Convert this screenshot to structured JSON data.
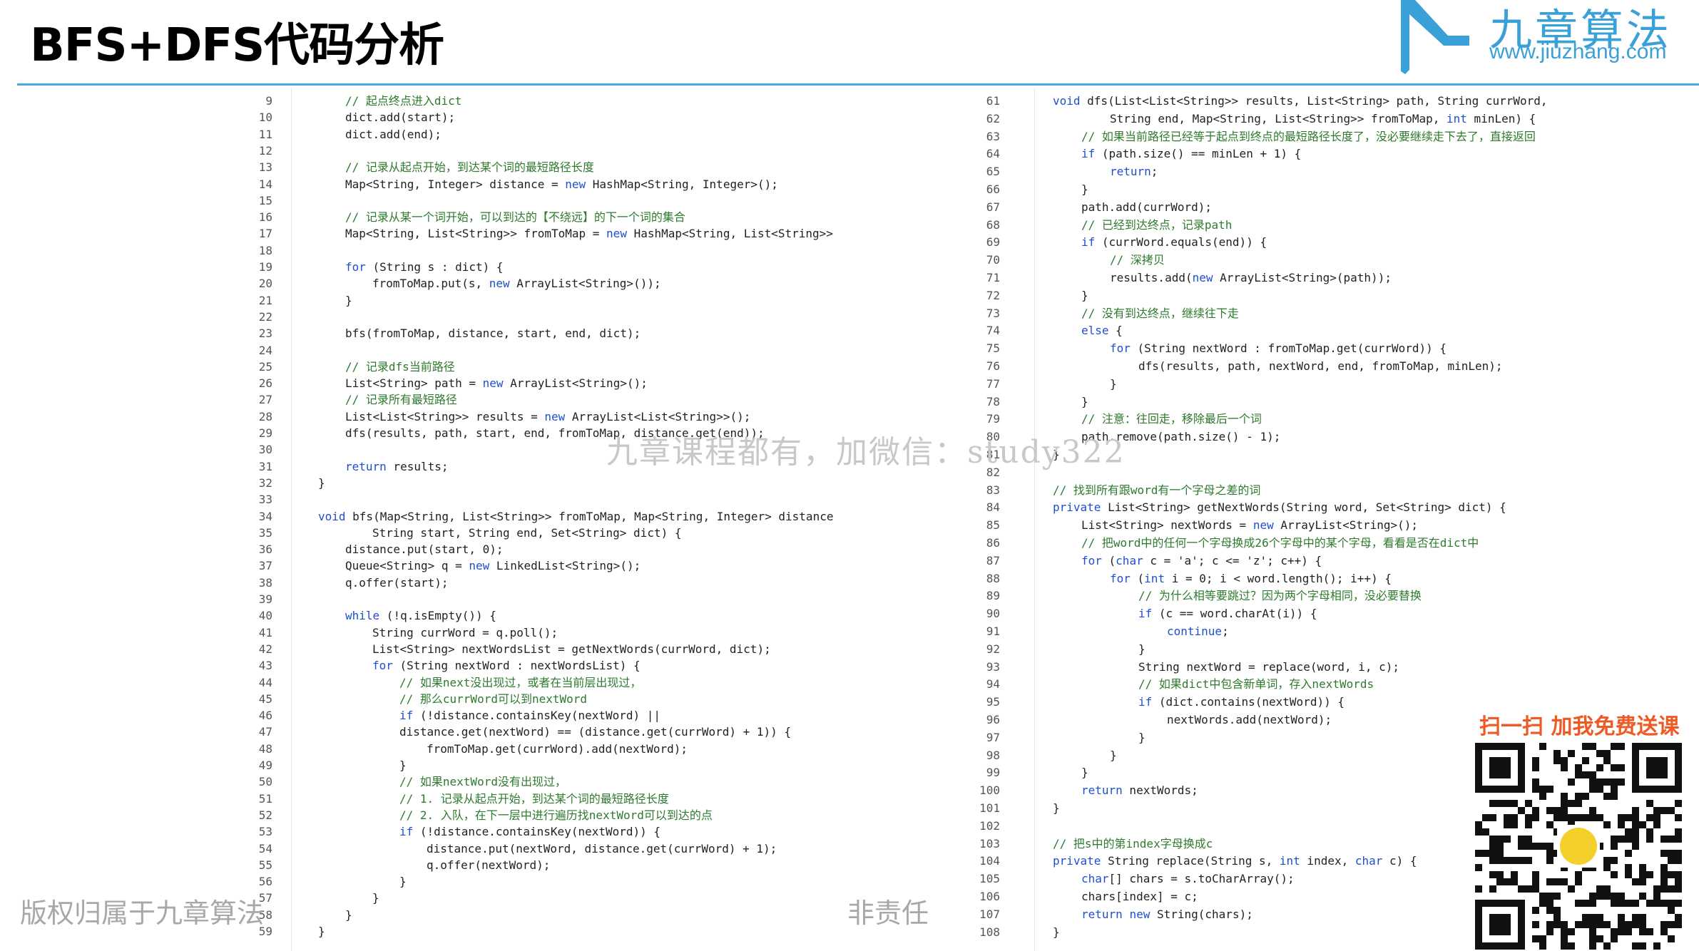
{
  "title": "BFS+DFS代码分析",
  "logo": {
    "text": "九章算法",
    "url": "www.jiuzhang.com"
  },
  "watermark": "九章课程都有，加微信：study322",
  "footer": {
    "copyright": "版权归属于九章算法",
    "disclaimer": "非责任"
  },
  "promo": "扫一扫 加我免费送课",
  "colors": {
    "accent": "#4aa9d8",
    "keyword": "#1f4fd1",
    "comment": "#2e7a2e",
    "promo": "#ee5a24"
  },
  "code_left": {
    "lines": [
      {
        "n": "9",
        "indent": 1,
        "t": "// 起点终点进入dict",
        "c": true
      },
      {
        "n": "10",
        "indent": 1,
        "t": "dict.add(start);"
      },
      {
        "n": "11",
        "indent": 1,
        "t": "dict.add(end);"
      },
      {
        "n": "12",
        "indent": 0,
        "t": ""
      },
      {
        "n": "13",
        "indent": 1,
        "t": "// 记录从起点开始，到达某个词的最短路径长度",
        "c": true
      },
      {
        "n": "14",
        "indent": 1,
        "t": "Map<String, Integer> distance = new HashMap<String, Integer>();"
      },
      {
        "n": "15",
        "indent": 0,
        "t": ""
      },
      {
        "n": "16",
        "indent": 1,
        "t": "// 记录从某一个词开始，可以到达的【不绕远】的下一个词的集合",
        "c": true
      },
      {
        "n": "17",
        "indent": 1,
        "t": "Map<String, List<String>> fromToMap = new HashMap<String, List<String>>();"
      },
      {
        "n": "18",
        "indent": 0,
        "t": ""
      },
      {
        "n": "19",
        "indent": 1,
        "t": "for (String s : dict) {"
      },
      {
        "n": "20",
        "indent": 2,
        "t": "fromToMap.put(s, new ArrayList<String>());"
      },
      {
        "n": "21",
        "indent": 1,
        "t": "}"
      },
      {
        "n": "22",
        "indent": 0,
        "t": ""
      },
      {
        "n": "23",
        "indent": 1,
        "t": "bfs(fromToMap, distance, start, end, dict);"
      },
      {
        "n": "24",
        "indent": 0,
        "t": ""
      },
      {
        "n": "25",
        "indent": 1,
        "t": "// 记录dfs当前路径",
        "c": true
      },
      {
        "n": "26",
        "indent": 1,
        "t": "List<String> path = new ArrayList<String>();"
      },
      {
        "n": "27",
        "indent": 1,
        "t": "// 记录所有最短路径",
        "c": true
      },
      {
        "n": "28",
        "indent": 1,
        "t": "List<List<String>> results = new ArrayList<List<String>>();"
      },
      {
        "n": "29",
        "indent": 1,
        "t": "dfs(results, path, start, end, fromToMap, distance.get(end));"
      },
      {
        "n": "30",
        "indent": 0,
        "t": ""
      },
      {
        "n": "31",
        "indent": 1,
        "t": "return results;"
      },
      {
        "n": "32",
        "indent": 0,
        "t": "}"
      },
      {
        "n": "33",
        "indent": 0,
        "t": ""
      },
      {
        "n": "34",
        "indent": 0,
        "t": "void bfs(Map<String, List<String>> fromToMap, Map<String, Integer> distance,"
      },
      {
        "n": "35",
        "indent": 2,
        "t": "String start, String end, Set<String> dict) {"
      },
      {
        "n": "36",
        "indent": 1,
        "t": "distance.put(start, 0);"
      },
      {
        "n": "37",
        "indent": 1,
        "t": "Queue<String> q = new LinkedList<String>();"
      },
      {
        "n": "38",
        "indent": 1,
        "t": "q.offer(start);"
      },
      {
        "n": "39",
        "indent": 0,
        "t": ""
      },
      {
        "n": "40",
        "indent": 1,
        "t": "while (!q.isEmpty()) {"
      },
      {
        "n": "41",
        "indent": 2,
        "t": "String currWord = q.poll();"
      },
      {
        "n": "42",
        "indent": 2,
        "t": "List<String> nextWordsList = getNextWords(currWord, dict);"
      },
      {
        "n": "43",
        "indent": 2,
        "t": "for (String nextWord : nextWordsList) {"
      },
      {
        "n": "44",
        "indent": 3,
        "t": "// 如果next没出现过，或者在当前层出现过，",
        "c": true
      },
      {
        "n": "45",
        "indent": 3,
        "t": "// 那么currWord可以到nextWord",
        "c": true
      },
      {
        "n": "46",
        "indent": 3,
        "t": "if (!distance.containsKey(nextWord) ||"
      },
      {
        "n": "47",
        "indent": 3,
        "t": "distance.get(nextWord) == (distance.get(currWord) + 1)) {"
      },
      {
        "n": "48",
        "indent": 4,
        "t": "fromToMap.get(currWord).add(nextWord);"
      },
      {
        "n": "49",
        "indent": 3,
        "t": "}"
      },
      {
        "n": "50",
        "indent": 3,
        "t": "// 如果nextWord没有出现过，",
        "c": true
      },
      {
        "n": "51",
        "indent": 3,
        "t": "// 1. 记录从起点开始，到达某个词的最短路径长度",
        "c": true
      },
      {
        "n": "52",
        "indent": 3,
        "t": "// 2. 入队，在下一层中进行遍历找nextWord可以到达的点",
        "c": true
      },
      {
        "n": "53",
        "indent": 3,
        "t": "if (!distance.containsKey(nextWord)) {"
      },
      {
        "n": "54",
        "indent": 4,
        "t": "distance.put(nextWord, distance.get(currWord) + 1);"
      },
      {
        "n": "55",
        "indent": 4,
        "t": "q.offer(nextWord);"
      },
      {
        "n": "56",
        "indent": 3,
        "t": "}"
      },
      {
        "n": "57",
        "indent": 2,
        "t": "}"
      },
      {
        "n": "58",
        "indent": 1,
        "t": "}"
      },
      {
        "n": "59",
        "indent": 0,
        "t": "}"
      }
    ]
  },
  "code_right": {
    "lines": [
      {
        "n": "61",
        "indent": 0,
        "t": "void dfs(List<List<String>> results, List<String> path, String currWord,"
      },
      {
        "n": "62",
        "indent": 2,
        "t": "String end, Map<String, List<String>> fromToMap, int minLen) {"
      },
      {
        "n": "63",
        "indent": 1,
        "t": "// 如果当前路径已经等于起点到终点的最短路径长度了，没必要继续走下去了，直接返回",
        "c": true
      },
      {
        "n": "64",
        "indent": 1,
        "t": "if (path.size() == minLen + 1) {"
      },
      {
        "n": "65",
        "indent": 2,
        "t": "return;"
      },
      {
        "n": "66",
        "indent": 1,
        "t": "}"
      },
      {
        "n": "67",
        "indent": 1,
        "t": "path.add(currWord);"
      },
      {
        "n": "68",
        "indent": 1,
        "t": "// 已经到达终点，记录path",
        "c": true
      },
      {
        "n": "69",
        "indent": 1,
        "t": "if (currWord.equals(end)) {"
      },
      {
        "n": "70",
        "indent": 2,
        "t": "// 深拷贝",
        "c": true
      },
      {
        "n": "71",
        "indent": 2,
        "t": "results.add(new ArrayList<String>(path));"
      },
      {
        "n": "72",
        "indent": 1,
        "t": "}"
      },
      {
        "n": "73",
        "indent": 1,
        "t": "// 没有到达终点，继续往下走",
        "c": true
      },
      {
        "n": "74",
        "indent": 1,
        "t": "else {"
      },
      {
        "n": "75",
        "indent": 2,
        "t": "for (String nextWord : fromToMap.get(currWord)) {"
      },
      {
        "n": "76",
        "indent": 3,
        "t": "dfs(results, path, nextWord, end, fromToMap, minLen);"
      },
      {
        "n": "77",
        "indent": 2,
        "t": "}"
      },
      {
        "n": "78",
        "indent": 1,
        "t": "}"
      },
      {
        "n": "79",
        "indent": 1,
        "t": "// 注意：往回走，移除最后一个词",
        "c": true
      },
      {
        "n": "80",
        "indent": 1,
        "t": "path.remove(path.size() - 1);"
      },
      {
        "n": "81",
        "indent": 0,
        "t": "}"
      },
      {
        "n": "82",
        "indent": 0,
        "t": ""
      },
      {
        "n": "83",
        "indent": 0,
        "t": "// 找到所有跟word有一个字母之差的词",
        "c": true
      },
      {
        "n": "84",
        "indent": 0,
        "t": "private List<String> getNextWords(String word, Set<String> dict) {"
      },
      {
        "n": "85",
        "indent": 1,
        "t": "List<String> nextWords = new ArrayList<String>();"
      },
      {
        "n": "86",
        "indent": 1,
        "t": "// 把word中的任何一个字母换成26个字母中的某个字母，看看是否在dict中",
        "c": true
      },
      {
        "n": "87",
        "indent": 1,
        "t": "for (char c = 'a'; c <= 'z'; c++) {"
      },
      {
        "n": "88",
        "indent": 2,
        "t": "for (int i = 0; i < word.length(); i++) {"
      },
      {
        "n": "89",
        "indent": 3,
        "t": "// 为什么相等要跳过？因为两个字母相同，没必要替换",
        "c": true
      },
      {
        "n": "90",
        "indent": 3,
        "t": "if (c == word.charAt(i)) {"
      },
      {
        "n": "91",
        "indent": 4,
        "t": "continue;"
      },
      {
        "n": "92",
        "indent": 3,
        "t": "}"
      },
      {
        "n": "93",
        "indent": 3,
        "t": "String nextWord = replace(word, i, c);"
      },
      {
        "n": "94",
        "indent": 3,
        "t": "// 如果dict中包含新单词，存入nextWords",
        "c": true
      },
      {
        "n": "95",
        "indent": 3,
        "t": "if (dict.contains(nextWord)) {"
      },
      {
        "n": "96",
        "indent": 4,
        "t": "nextWords.add(nextWord);"
      },
      {
        "n": "97",
        "indent": 3,
        "t": "}"
      },
      {
        "n": "98",
        "indent": 2,
        "t": "}"
      },
      {
        "n": "99",
        "indent": 1,
        "t": "}"
      },
      {
        "n": "100",
        "indent": 1,
        "t": "return nextWords;"
      },
      {
        "n": "101",
        "indent": 0,
        "t": "}"
      },
      {
        "n": "102",
        "indent": 0,
        "t": ""
      },
      {
        "n": "103",
        "indent": 0,
        "t": "// 把s中的第index字母换成c",
        "c": true
      },
      {
        "n": "104",
        "indent": 0,
        "t": "private String replace(String s, int index, char c) {"
      },
      {
        "n": "105",
        "indent": 1,
        "t": "char[] chars = s.toCharArray();"
      },
      {
        "n": "106",
        "indent": 1,
        "t": "chars[index] = c;"
      },
      {
        "n": "107",
        "indent": 1,
        "t": "return new String(chars);"
      },
      {
        "n": "108",
        "indent": 0,
        "t": "}"
      }
    ]
  }
}
